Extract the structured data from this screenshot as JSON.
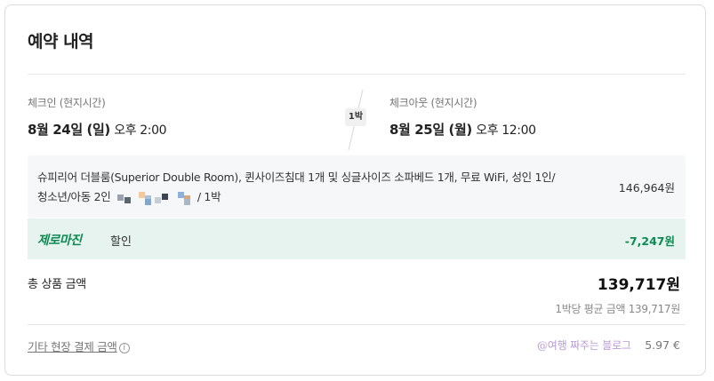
{
  "reservation": {
    "title": "예약 내역",
    "checkin": {
      "label": "체크인 (현지시간)",
      "date": "8월 24일 (일)",
      "time": "오후 2:00"
    },
    "checkout": {
      "label": "체크아웃 (현지시간)",
      "date": "8월 25일 (월)",
      "time": "오후 12:00"
    },
    "nights": "1박"
  },
  "room": {
    "description_line1": "슈피리어 더블룸(Superior Double Room), 퀸사이즈침대 1개 및 싱글사이즈 소파베드 1개, 무료 WiFi, 성인 1인/",
    "description_line2_prefix": "청소년/아동 2인",
    "description_line2_suffix": "/ 1박",
    "price": "146,964원"
  },
  "discount": {
    "brand": "제로마진",
    "label": "할인",
    "amount": "-7,247원"
  },
  "total": {
    "label": "총 상품 금액",
    "amount": "139,717원",
    "per_night": "1박당 평균 금액 139,717원"
  },
  "onsite": {
    "label": "기타 현장 결제 금액",
    "info_icon": "i",
    "amount": "5.97 €"
  },
  "watermark": "@여행 짜주는 블로그",
  "colors": {
    "accent_green": "#0c8a52",
    "discount_bg": "#e7f3ee",
    "room_bg": "#f5f7f9",
    "watermark": "#b99ad6"
  }
}
